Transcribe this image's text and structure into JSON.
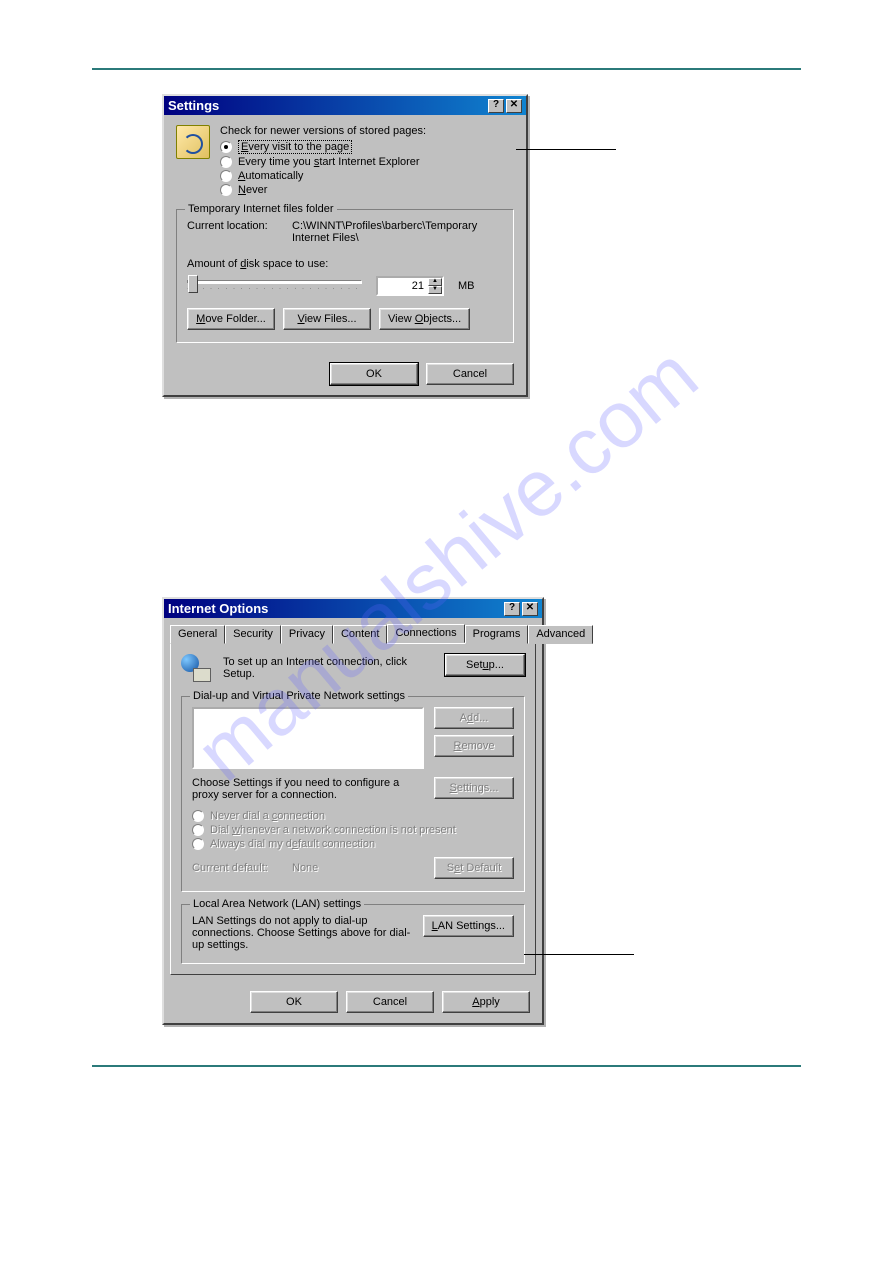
{
  "settings_dialog": {
    "title": "Settings",
    "check_label": "Check for newer versions of stored pages:",
    "radios": [
      "Every visit to the page",
      "Every time you start Internet Explorer",
      "Automatically",
      "Never"
    ],
    "selected_radio": 0,
    "temp_group_label": "Temporary Internet files folder",
    "current_location_label": "Current location:",
    "current_location_value": "C:\\WINNT\\Profiles\\barberc\\Temporary Internet Files\\",
    "disk_space_label": "Amount of disk space to use:",
    "disk_space_value": "21",
    "disk_space_unit": "MB",
    "buttons": {
      "move_folder": "Move Folder...",
      "view_files": "View Files...",
      "view_objects": "View Objects..."
    },
    "ok": "OK",
    "cancel": "Cancel"
  },
  "internet_options_dialog": {
    "title": "Internet Options",
    "tabs": [
      "General",
      "Security",
      "Privacy",
      "Content",
      "Connections",
      "Programs",
      "Advanced"
    ],
    "active_tab": 4,
    "setup_text": "To set up an Internet connection, click Setup.",
    "setup_button": "Setup...",
    "dialup_group": "Dial-up and Virtual Private Network settings",
    "add_button": "Add...",
    "remove_button": "Remove",
    "settings_button": "Settings...",
    "proxy_hint": "Choose Settings if you need to configure a proxy server for a connection.",
    "dial_radios": [
      "Never dial a connection",
      "Dial whenever a network connection is not present",
      "Always dial my default connection"
    ],
    "current_default_label": "Current default:",
    "current_default_value": "None",
    "set_default_button": "Set Default",
    "lan_group": "Local Area Network (LAN) settings",
    "lan_hint": "LAN Settings do not apply to dial-up connections. Choose Settings above for dial-up settings.",
    "lan_button": "LAN Settings...",
    "ok": "OK",
    "cancel": "Cancel",
    "apply": "Apply"
  },
  "watermark": "manualshive.com"
}
